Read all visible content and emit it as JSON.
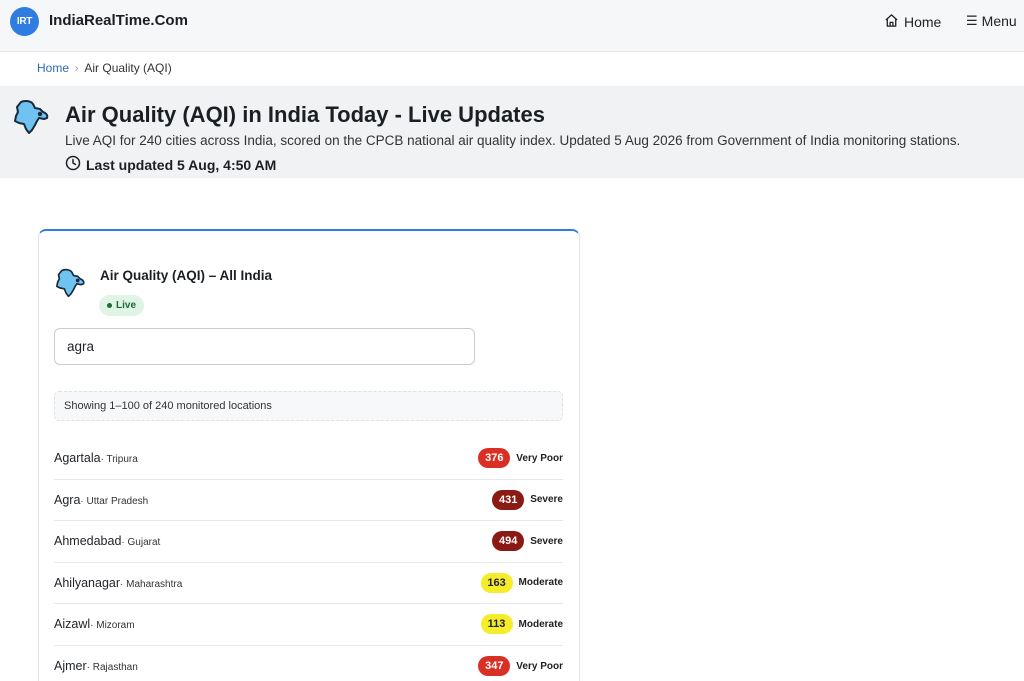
{
  "header": {
    "logo_text": "IRT",
    "site_name": "IndiaRealTime.Com",
    "nav_home": "Home",
    "nav_menu": "Menu",
    "menu_glyph": "☰",
    "home_icon": "house-icon",
    "accent_color": "#2f7de1"
  },
  "breadcrumb": {
    "home": "Home",
    "separator": "›",
    "current": "Air Quality (AQI)"
  },
  "hero": {
    "title": "Air Quality (AQI) in India Today - Live Updates",
    "description": "Live AQI for 240 cities across India, scored on the CPCB national air quality index. Updated 5 Aug 2026 from Government of India monitoring stations.",
    "last_updated": "Last updated 5 Aug, 4:50 AM",
    "icon": "india-map-icon"
  },
  "card": {
    "title": "Air Quality (AQI) – All India",
    "live_label": "Live",
    "search_value": "agra",
    "showing_text": "Showing 1–100 of 240 monitored locations",
    "rows": [
      {
        "city": "Agartala",
        "state": " · Tripura",
        "aqi": "376",
        "category": "Very Poor",
        "bg": "#d93025",
        "fg": "#ffffff"
      },
      {
        "city": "Agra",
        "state": " · Uttar Pradesh",
        "aqi": "431",
        "category": "Severe",
        "bg": "#8b1a14",
        "fg": "#ffffff"
      },
      {
        "city": "Ahmedabad",
        "state": " · Gujarat",
        "aqi": "494",
        "category": "Severe",
        "bg": "#8b1a14",
        "fg": "#ffffff"
      },
      {
        "city": "Ahilyanagar",
        "state": " · Maharashtra",
        "aqi": "163",
        "category": "Moderate",
        "bg": "#f5ec2a",
        "fg": "#1f2328"
      },
      {
        "city": "Aizawl",
        "state": " · Mizoram",
        "aqi": "113",
        "category": "Moderate",
        "bg": "#f5ec2a",
        "fg": "#1f2328"
      },
      {
        "city": "Ajmer",
        "state": " · Rajasthan",
        "aqi": "347",
        "category": "Very Poor",
        "bg": "#d93025",
        "fg": "#ffffff"
      }
    ]
  }
}
